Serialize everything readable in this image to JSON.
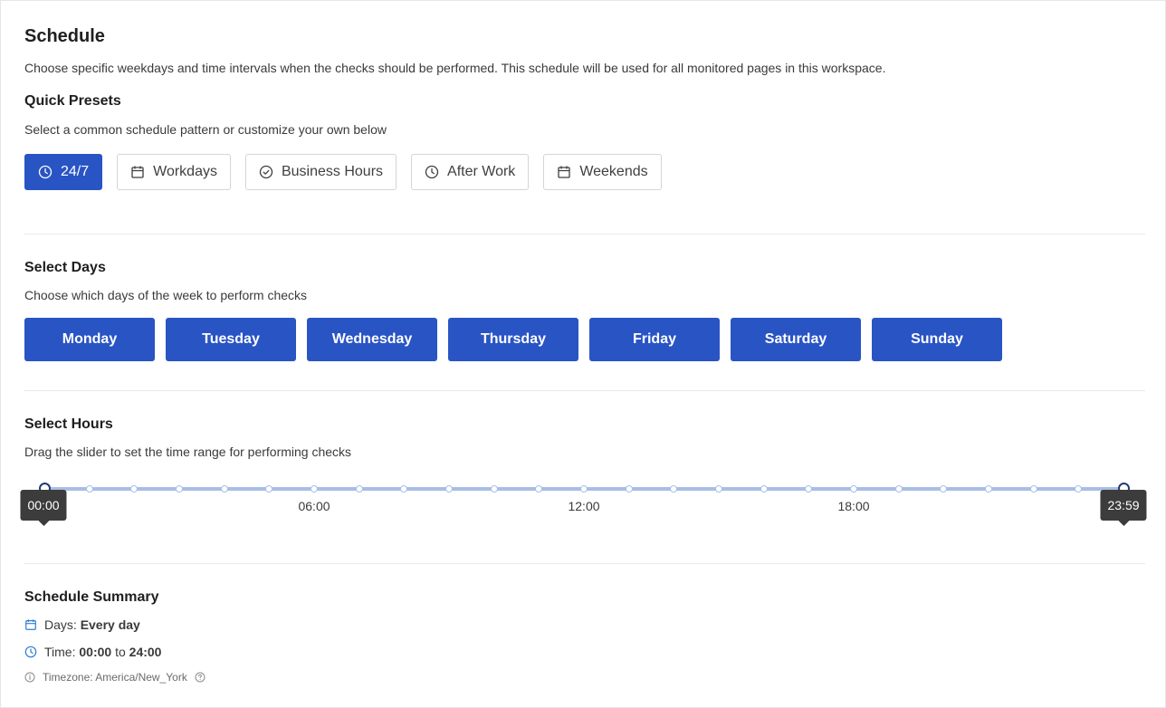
{
  "header": {
    "title": "Schedule",
    "description": "Choose specific weekdays and time intervals when the checks should be performed. This schedule will be used for all monitored pages in this workspace."
  },
  "presets": {
    "title": "Quick Presets",
    "subtitle": "Select a common schedule pattern or customize your own below",
    "items": [
      {
        "label": "24/7",
        "icon": "clock-icon",
        "active": true
      },
      {
        "label": "Workdays",
        "icon": "calendar-icon",
        "active": false
      },
      {
        "label": "Business Hours",
        "icon": "check-circle-icon",
        "active": false
      },
      {
        "label": "After Work",
        "icon": "clock-icon",
        "active": false
      },
      {
        "label": "Weekends",
        "icon": "calendar-icon",
        "active": false
      }
    ]
  },
  "days": {
    "title": "Select Days",
    "subtitle": "Choose which days of the week to perform checks",
    "items": [
      "Monday",
      "Tuesday",
      "Wednesday",
      "Thursday",
      "Friday",
      "Saturday",
      "Sunday"
    ],
    "selected": [
      "Monday",
      "Tuesday",
      "Wednesday",
      "Thursday",
      "Friday",
      "Saturday",
      "Sunday"
    ]
  },
  "hours": {
    "title": "Select Hours",
    "subtitle": "Drag the slider to set the time range for performing checks",
    "tick_labels": [
      "06:00",
      "12:00",
      "18:00"
    ],
    "start": "00:00",
    "end": "23:59"
  },
  "summary": {
    "title": "Schedule Summary",
    "days_label": "Days: ",
    "days_value": "Every day",
    "time_label": "Time: ",
    "time_start": "00:00",
    "time_to": " to ",
    "time_end": "24:00",
    "timezone": "Timezone: America/New_York"
  },
  "colors": {
    "accent": "#2954c4",
    "track": "#a9bde6",
    "tooltip": "#3c3c3c",
    "summary_icon": "#2f7fd6"
  }
}
